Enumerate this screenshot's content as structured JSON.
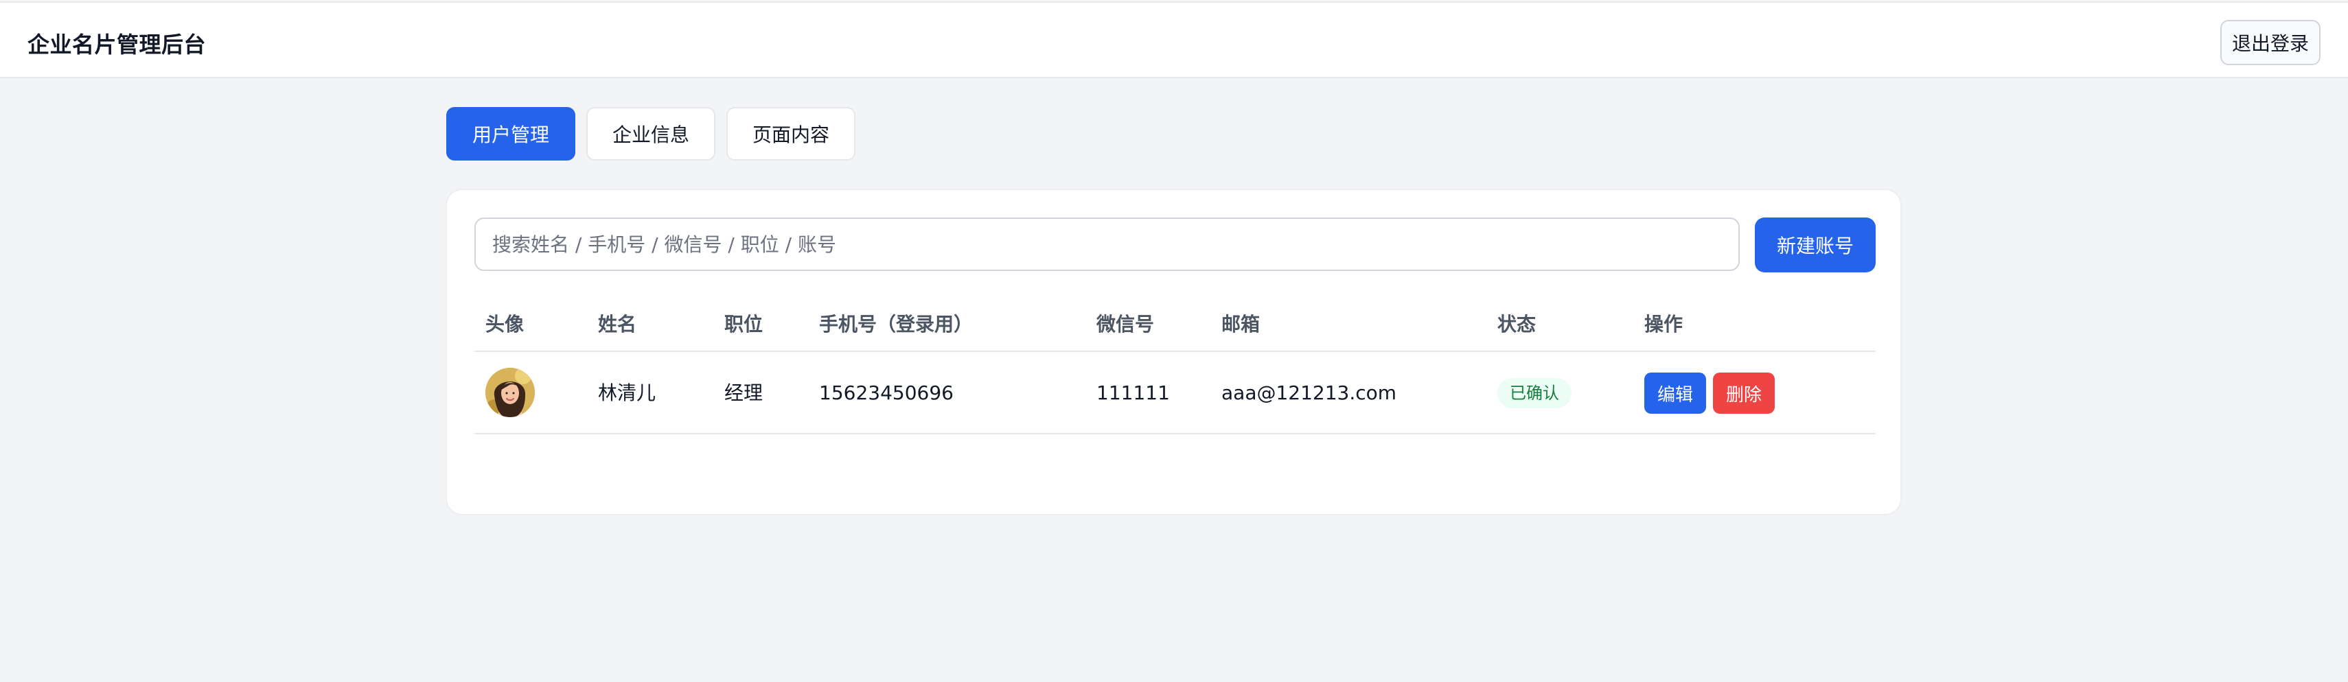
{
  "header": {
    "title": "企业名片管理后台",
    "logout_label": "退出登录"
  },
  "tabs": [
    {
      "label": "用户管理",
      "active": true
    },
    {
      "label": "企业信息",
      "active": false
    },
    {
      "label": "页面内容",
      "active": false
    }
  ],
  "toolbar": {
    "search_placeholder": "搜索姓名 / 手机号 / 微信号 / 职位 / 账号",
    "search_value": "",
    "create_label": "新建账号"
  },
  "table": {
    "columns": {
      "avatar": "头像",
      "name": "姓名",
      "title": "职位",
      "phone": "手机号（登录用）",
      "wechat": "微信号",
      "email": "邮箱",
      "status": "状态",
      "actions": "操作"
    },
    "rows": [
      {
        "avatar_icon": "user-photo",
        "name": "林清儿",
        "title": "经理",
        "phone": "15623450696",
        "wechat": "111111",
        "email": "aaa@121213.com",
        "status": "已确认",
        "edit_label": "编辑",
        "delete_label": "删除"
      }
    ]
  },
  "colors": {
    "primary": "#2563eb",
    "danger": "#ef4444",
    "success_text": "#15803d",
    "success_bg": "#ecfdf5",
    "page_bg": "#f3f4f6"
  }
}
